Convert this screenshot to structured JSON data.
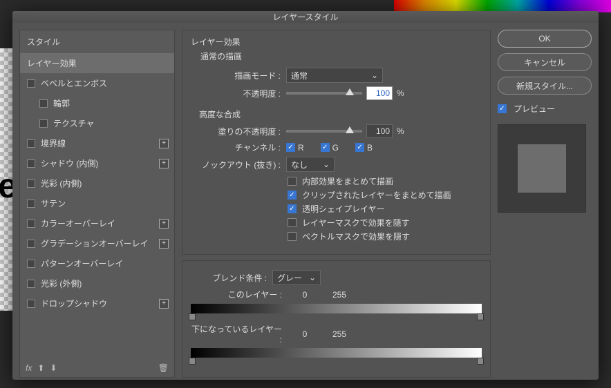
{
  "window": {
    "title": "レイヤースタイル"
  },
  "sidebar": {
    "header": "スタイル",
    "items": [
      {
        "label": "レイヤー効果",
        "selected": true,
        "checkbox": false,
        "indent": false,
        "plus": false
      },
      {
        "label": "ベベルとエンボス",
        "checkbox": true,
        "indent": false,
        "plus": false
      },
      {
        "label": "輪郭",
        "checkbox": true,
        "indent": true,
        "plus": false
      },
      {
        "label": "テクスチャ",
        "checkbox": true,
        "indent": true,
        "plus": false
      },
      {
        "label": "境界線",
        "checkbox": true,
        "indent": false,
        "plus": true
      },
      {
        "label": "シャドウ (内側)",
        "checkbox": true,
        "indent": false,
        "plus": true
      },
      {
        "label": "光彩 (内側)",
        "checkbox": true,
        "indent": false,
        "plus": false
      },
      {
        "label": "サテン",
        "checkbox": true,
        "indent": false,
        "plus": false
      },
      {
        "label": "カラーオーバーレイ",
        "checkbox": true,
        "indent": false,
        "plus": true
      },
      {
        "label": "グラデーションオーバーレイ",
        "checkbox": true,
        "indent": false,
        "plus": true
      },
      {
        "label": "パターンオーバーレイ",
        "checkbox": true,
        "indent": false,
        "plus": false
      },
      {
        "label": "光彩 (外側)",
        "checkbox": true,
        "indent": false,
        "plus": false
      },
      {
        "label": "ドロップシャドウ",
        "checkbox": true,
        "indent": false,
        "plus": true
      }
    ],
    "fx": "fx"
  },
  "main": {
    "title": "レイヤー効果",
    "normal": {
      "title": "通常の描画",
      "blend_mode_label": "描画モード :",
      "blend_mode_value": "通常",
      "opacity_label": "不透明度 :",
      "opacity_value": "100",
      "opacity_unit": "%"
    },
    "advanced": {
      "title": "高度な合成",
      "fill_label": "塗りの不透明度 :",
      "fill_value": "100",
      "fill_unit": "%",
      "channel_label": "チャンネル :",
      "ch_r": "R",
      "ch_g": "G",
      "ch_b": "B",
      "knockout_label": "ノックアウト (抜き) :",
      "knockout_value": "なし",
      "checks": [
        {
          "label": "内部効果をまとめて描画",
          "on": false
        },
        {
          "label": "クリップされたレイヤーをまとめて描画",
          "on": true
        },
        {
          "label": "透明シェイプレイヤー",
          "on": true
        },
        {
          "label": "レイヤーマスクで効果を隠す",
          "on": false
        },
        {
          "label": "ベクトルマスクで効果を隠す",
          "on": false
        }
      ]
    },
    "blend": {
      "label": "ブレンド条件 :",
      "value": "グレー",
      "this_layer_label": "このレイヤー :",
      "this_low": "0",
      "this_high": "255",
      "under_layer_label": "下になっているレイヤー :",
      "under_low": "0",
      "under_high": "255"
    }
  },
  "right": {
    "ok": "OK",
    "cancel": "キャンセル",
    "new_style": "新規スタイル...",
    "preview": "プレビュー"
  }
}
